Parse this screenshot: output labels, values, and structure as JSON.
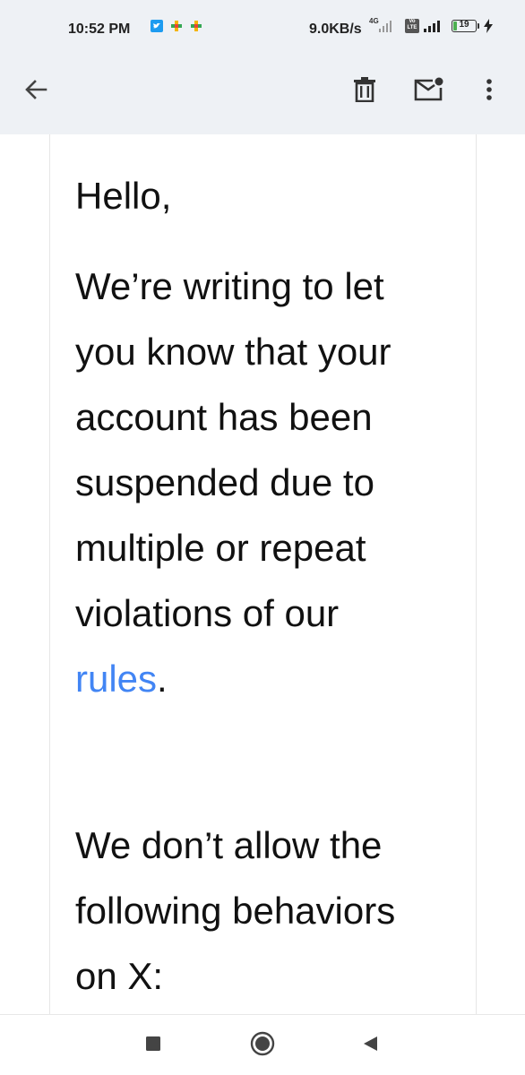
{
  "status_bar": {
    "time": "10:52 PM",
    "network_rate": "9.0KB/s",
    "network_type": "4G",
    "volte_label": "Vo LTE",
    "battery_level": "19",
    "battery_fraction": 0.19,
    "left_icons": [
      "twitter-icon",
      "app-notification-icon",
      "app-notification-icon"
    ],
    "right_icons": [
      "signal-icon",
      "volte-icon",
      "signal-icon",
      "battery-icon",
      "charging-icon"
    ]
  },
  "app_bar": {
    "icons": [
      "back-arrow-icon",
      "delete-icon",
      "mark-unread-icon",
      "more-vert-icon"
    ]
  },
  "email": {
    "greeting": "Hello,",
    "para1_lines": [
      "We’re writing to let",
      "you know that your",
      "account has been",
      "suspended due to",
      "multiple or repeat",
      "violations of our"
    ],
    "rules_link": "rules",
    "rules_suffix": ".",
    "para2_lines": [
      "We don’t allow the",
      "following behaviors",
      "on X:"
    ]
  },
  "nav_bar": {
    "icons": [
      "recent-apps-icon",
      "home-icon",
      "back-icon"
    ]
  },
  "colors": {
    "top_bar_bg": "#eef1f5",
    "link": "#4285f4",
    "text": "#111111",
    "battery": "#4caf50"
  }
}
